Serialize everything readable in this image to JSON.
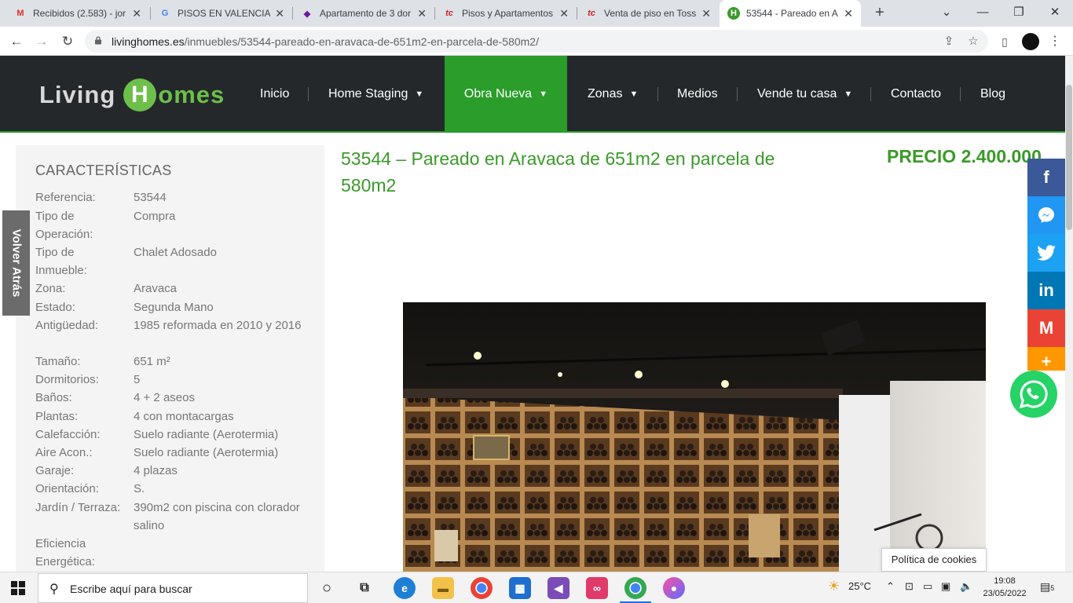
{
  "browser": {
    "tabs": [
      {
        "title": "Recibidos (2.583) - jor",
        "icon": "gmail-icon",
        "color": "#d93025"
      },
      {
        "title": "PISOS EN VALENCIA -",
        "icon": "google-icon",
        "color": "#4285f4"
      },
      {
        "title": "Apartamento de 3 dor",
        "icon": "site-icon",
        "color": "#6a1b9a"
      },
      {
        "title": "Pisos y Apartamentos",
        "icon": "tc-icon",
        "color": "#c62828"
      },
      {
        "title": "Venta de piso en Toss",
        "icon": "tc-icon",
        "color": "#c62828"
      },
      {
        "title": "53544 - Pareado en A",
        "icon": "livinghomes-icon",
        "color": "#3a9a2a"
      }
    ],
    "new_tab": "+",
    "url_domain": "livinghomes.es",
    "url_path": "/inmuebles/53544-pareado-en-aravaca-de-651m2-en-parcela-de-580m2/"
  },
  "header": {
    "logo_left": "Living",
    "logo_h": "H",
    "logo_right": "omes",
    "nav": [
      {
        "label": "Inicio",
        "dropdown": false
      },
      {
        "label": "Home Staging",
        "dropdown": true
      },
      {
        "label": "Obra Nueva",
        "dropdown": true,
        "active": true
      },
      {
        "label": "Zonas",
        "dropdown": true
      },
      {
        "label": "Medios",
        "dropdown": false
      },
      {
        "label": "Vende tu casa",
        "dropdown": true
      },
      {
        "label": "Contacto",
        "dropdown": false
      },
      {
        "label": "Blog",
        "dropdown": false
      }
    ]
  },
  "characteristics": {
    "title": "CARACTERÍSTICAS",
    "rows": [
      {
        "label": "Referencia:",
        "value": "53544"
      },
      {
        "label": "Tipo de Operación:",
        "value": "Compra"
      },
      {
        "label": "Tipo de Inmueble:",
        "value": "Chalet Adosado"
      },
      {
        "label": "Zona:",
        "value": "Aravaca"
      },
      {
        "label": "Estado:",
        "value": "Segunda Mano"
      },
      {
        "label": "Antigüedad:",
        "value": "1985 reformada en 2010 y 2016"
      },
      {
        "label": "Tamaño:",
        "value": "651 m²"
      },
      {
        "label": "Dormitorios:",
        "value": "5"
      },
      {
        "label": "Baños:",
        "value": "4 + 2 aseos"
      },
      {
        "label": "Plantas:",
        "value": "4 con montacargas"
      },
      {
        "label": "Calefacción:",
        "value": "Suelo radiante (Aerotermia)"
      },
      {
        "label": "Aire Acon.:",
        "value": "Suelo radiante (Aerotermia)"
      },
      {
        "label": "Garaje:",
        "value": "4 plazas"
      },
      {
        "label": "Orientación:",
        "value": "S."
      },
      {
        "label": "Jardín / Terraza:",
        "value": "390m2 con piscina con clorador salino"
      },
      {
        "label": "Eficiencia Energética:",
        "value": ""
      }
    ]
  },
  "back_button": "Volver Atrás",
  "property": {
    "title": "53544 – Pareado en Aravaca de 651m2 en parcela de 580m2",
    "price": "PRECIO 2.400.000"
  },
  "share": [
    {
      "icon": "facebook-icon",
      "glyph": "f",
      "color": "#3b5998"
    },
    {
      "icon": "messenger-icon",
      "glyph": "✉",
      "color": "#2196f3"
    },
    {
      "icon": "twitter-icon",
      "glyph": "t",
      "color": "#1da1f2"
    },
    {
      "icon": "linkedin-icon",
      "glyph": "in",
      "color": "#0077b5"
    },
    {
      "icon": "gmail-icon",
      "glyph": "M",
      "color": "#ea4335"
    },
    {
      "icon": "more-share-icon",
      "glyph": "+",
      "color": "#ff9800"
    }
  ],
  "cookies": "Política de cookies",
  "taskbar": {
    "search_placeholder": "Escribe aquí para buscar",
    "weather": "25°C",
    "time": "19:08",
    "date": "23/05/2022",
    "notifications": "5"
  }
}
